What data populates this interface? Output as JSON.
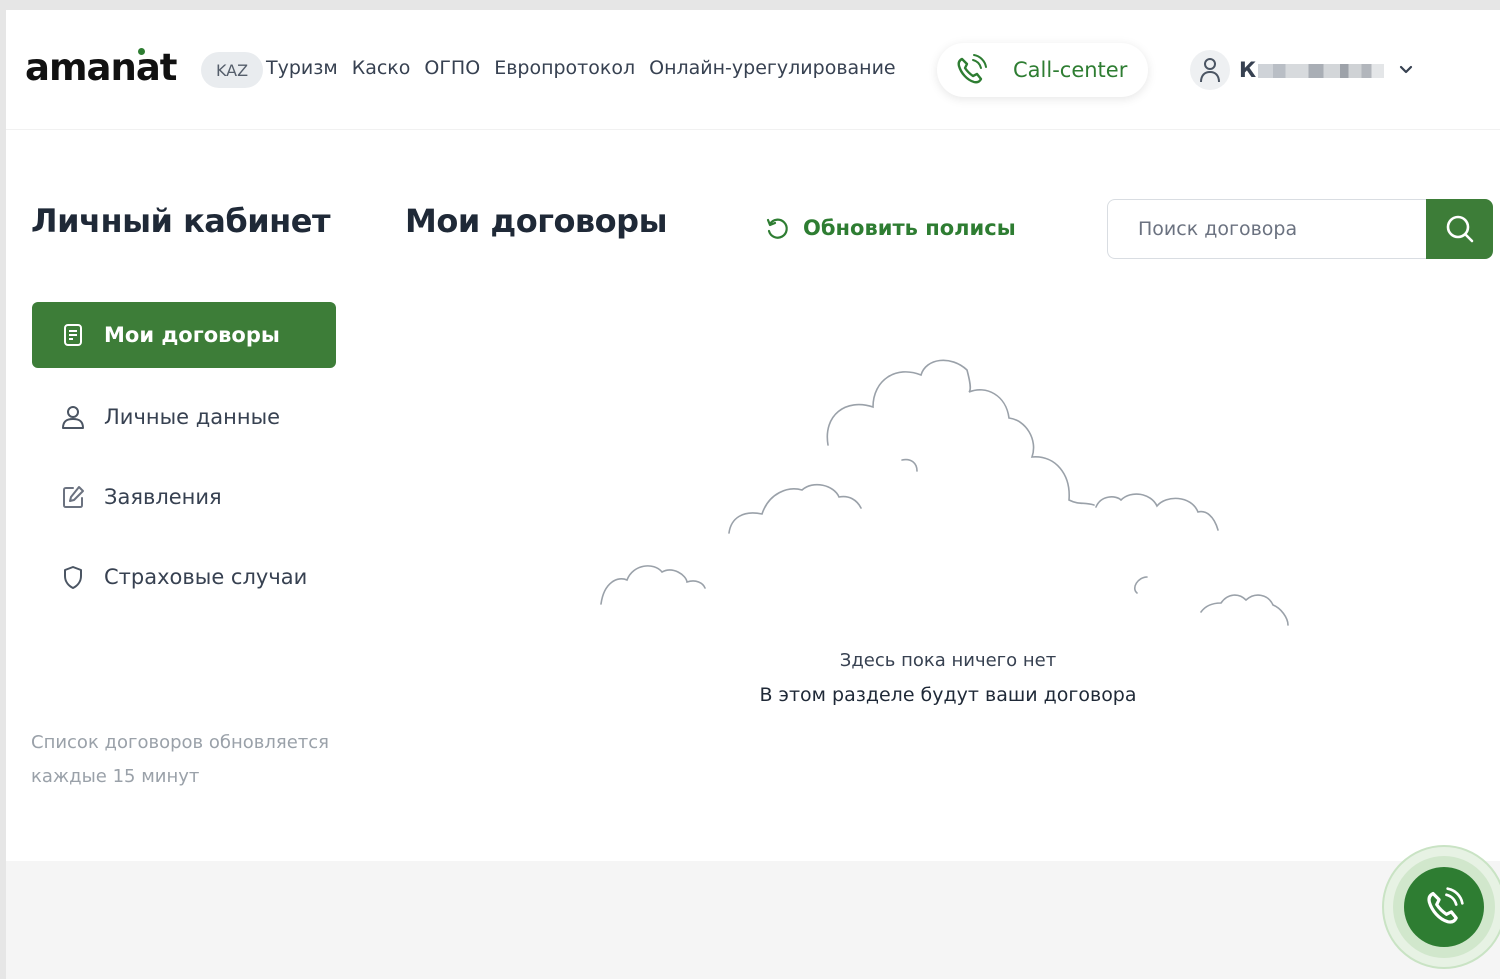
{
  "header": {
    "logo": "amanat",
    "language": "KAZ",
    "nav": [
      "Туризм",
      "Каско",
      "ОГПО",
      "Европротокол",
      "Онлайн-урегулирование"
    ],
    "call_center": "Call-center",
    "user_initial": "К"
  },
  "sidebar": {
    "title": "Личный кабинет",
    "items": [
      {
        "label": "Мои договоры",
        "icon": "document-icon",
        "active": true
      },
      {
        "label": "Личные данные",
        "icon": "user-icon",
        "active": false
      },
      {
        "label": "Заявления",
        "icon": "edit-icon",
        "active": false
      },
      {
        "label": "Страховые случаи",
        "icon": "shield-icon",
        "active": false
      }
    ],
    "note": "Список договоров обновляется каждые 15 минут"
  },
  "main": {
    "title": "Мои договоры",
    "refresh_label": "Обновить полисы",
    "search_placeholder": "Поиск договора",
    "empty_title": "Здесь пока ничего нет",
    "empty_subtitle": "В этом разделе будут ваши договора"
  },
  "colors": {
    "brand_green": "#3d7d38",
    "text_green": "#2e7d32"
  }
}
